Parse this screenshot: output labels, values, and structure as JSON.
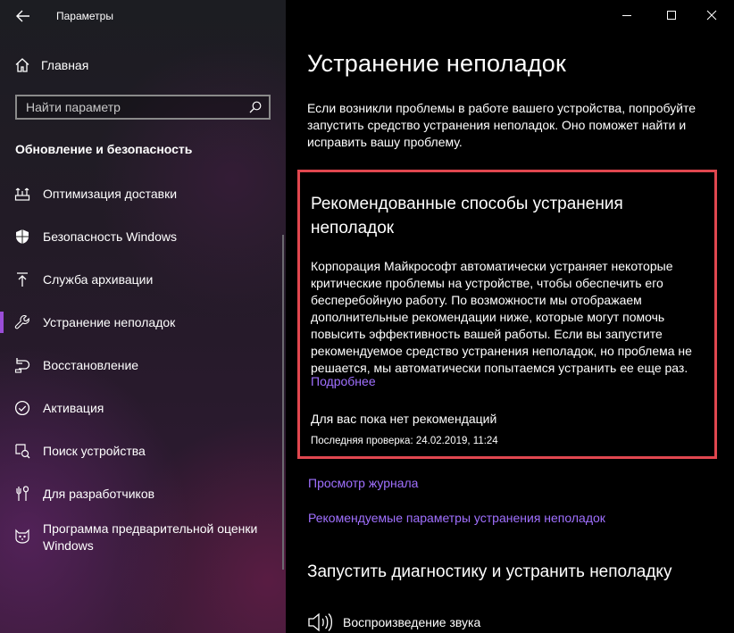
{
  "window": {
    "title": "Параметры",
    "back_icon": "back-arrow-icon",
    "controls": [
      "minimize-icon",
      "maximize-icon",
      "close-icon"
    ]
  },
  "sidebar": {
    "home_label": "Главная",
    "search_placeholder": "Найти параметр",
    "section_title": "Обновление и безопасность",
    "items": [
      {
        "label": "Оптимизация доставки",
        "icon": "delivery-optimization-icon"
      },
      {
        "label": "Безопасность Windows",
        "icon": "shield-icon"
      },
      {
        "label": "Служба архивации",
        "icon": "backup-arrow-icon"
      },
      {
        "label": "Устранение неполадок",
        "icon": "wrench-icon",
        "active": true
      },
      {
        "label": "Восстановление",
        "icon": "recovery-icon"
      },
      {
        "label": "Активация",
        "icon": "check-circle-icon"
      },
      {
        "label": "Поиск устройства",
        "icon": "find-device-icon"
      },
      {
        "label": "Для разработчиков",
        "icon": "developer-icon"
      },
      {
        "label": "Программа предварительной оценки Windows",
        "icon": "insider-cat-icon"
      }
    ]
  },
  "main": {
    "title": "Устранение неполадок",
    "intro": "Если возникли проблемы в работе вашего устройства, попробуйте запустить средство устранения неполадок. Оно поможет найти и исправить вашу проблему.",
    "recommended": {
      "title": "Рекомендованные способы устранения неполадок",
      "body": "Корпорация Майкрософт автоматически устраняет некоторые критические проблемы на устройстве, чтобы обеспечить его бесперебойную работу. По возможности мы отображаем дополнительные рекомендации ниже, которые могут помочь повысить эффективность вашей работы. Если вы запустите рекомендуемое средство устранения неполадок, но проблема не решается, мы автоматически попытаемся устранить ее еще раз.",
      "more_link": "Подробнее",
      "none_text": "Для вас пока нет рекомендаций",
      "last_check": "Последняя проверка: 24.02.2019, 11:24"
    },
    "journal_link": "Просмотр журнала",
    "recommended_settings_link": "Рекомендуемые параметры устранения неполадок",
    "diagnostics_title": "Запустить диагностику и устранить неполадку",
    "sound_label": "Воспроизведение звука"
  },
  "colors": {
    "accent_link": "#a070ff",
    "highlight_border": "#e0474f",
    "active_bar": "#9a4dd8"
  }
}
